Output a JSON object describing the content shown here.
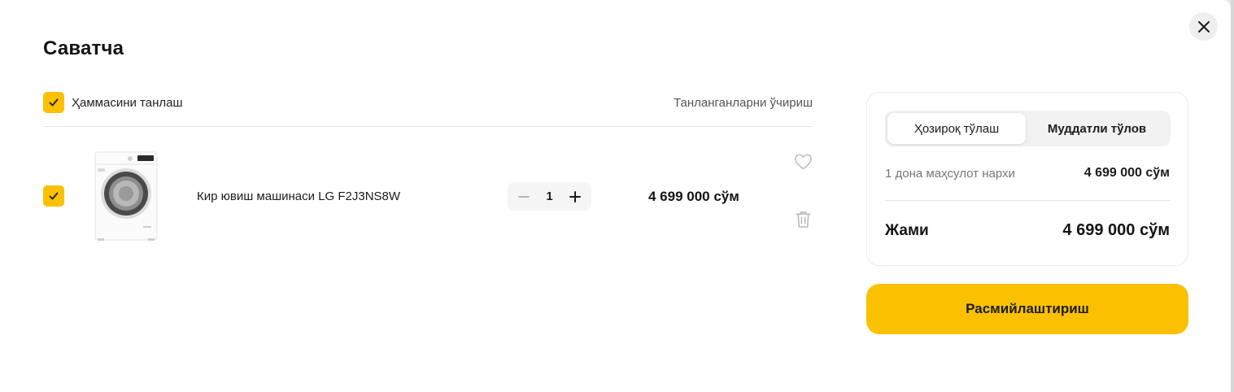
{
  "cart": {
    "title": "Саватча",
    "close_icon": "close-icon",
    "select_all_label": "Ҳаммасини танлаш",
    "delete_selected_label": "Танланганларни ўчириш",
    "items": [
      {
        "name": "Кир ювиш машинаси LG F2J3NS8W",
        "image_icon": "washing-machine-image",
        "quantity": "1",
        "price": "4 699 000 сўм",
        "checked": true
      }
    ]
  },
  "summary": {
    "tabs": [
      {
        "label": "Ҳозироқ тўлаш",
        "active": true
      },
      {
        "label": "Муддатли тўлов",
        "active": false
      }
    ],
    "unit_price_label": "1 дона маҳсулот нархи",
    "unit_price_value": "4 699 000 сўм",
    "total_label": "Жами",
    "total_value": "4 699 000 сўм",
    "checkout_label": "Расмийлаштириш"
  },
  "colors": {
    "accent": "#fbc100",
    "background": "#ffffff",
    "text": "#141414"
  }
}
